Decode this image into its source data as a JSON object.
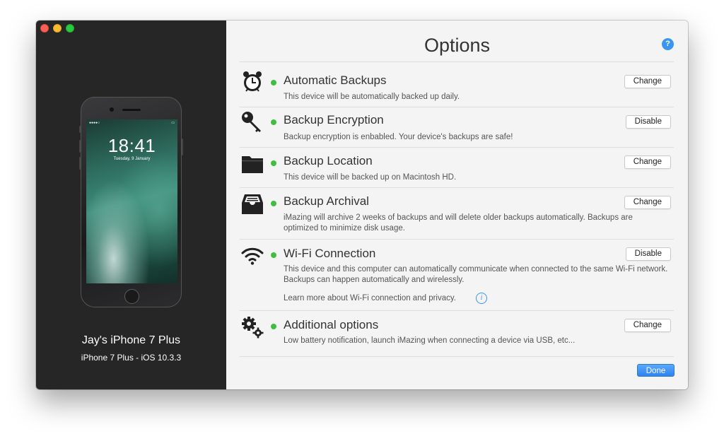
{
  "device": {
    "lock_time": "18:41",
    "lock_date": "Tuesday, 9 January",
    "name": "Jay's iPhone 7 Plus",
    "model": "iPhone 7 Plus - iOS 10.3.3"
  },
  "options": {
    "title": "Options",
    "help_icon_label": "?",
    "items": [
      {
        "icon": "alarm-clock-icon",
        "title": "Automatic Backups",
        "description": "This device will be automatically backed up daily.",
        "button": "Change",
        "status_color": "#3fbf3f"
      },
      {
        "icon": "key-icon",
        "title": "Backup Encryption",
        "description": "Backup encryption is enbabled. Your device's backups are safe!",
        "button": "Disable",
        "status_color": "#3fbf3f"
      },
      {
        "icon": "folder-icon",
        "title": "Backup Location",
        "description": "This device will be backed up on Macintosh HD.",
        "button": "Change",
        "status_color": "#3fbf3f"
      },
      {
        "icon": "archive-tray-icon",
        "title": "Backup Archival",
        "description": "iMazing will archive 2 weeks of backups and will delete older backups automatically. Backups are optimized to minimize disk usage.",
        "button": "Change",
        "status_color": "#3fbf3f"
      },
      {
        "icon": "wifi-icon",
        "title": "Wi-Fi Connection",
        "description": "This device and this computer can automatically communicate when connected to the same Wi-Fi network. Backups can happen automatically and wirelessly.",
        "learn_more": "Learn more about Wi-Fi connection and privacy.",
        "button": "Disable",
        "status_color": "#3fbf3f"
      },
      {
        "icon": "gears-icon",
        "title": "Additional options",
        "description": "Low battery notification, launch iMazing when connecting a device via USB, etc...",
        "button": "Change",
        "status_color": "#3fbf3f"
      }
    ],
    "done_label": "Done"
  },
  "colors": {
    "accent": "#3a96ef",
    "status_green": "#3fbf3f",
    "sidebar_bg": "#262626"
  }
}
